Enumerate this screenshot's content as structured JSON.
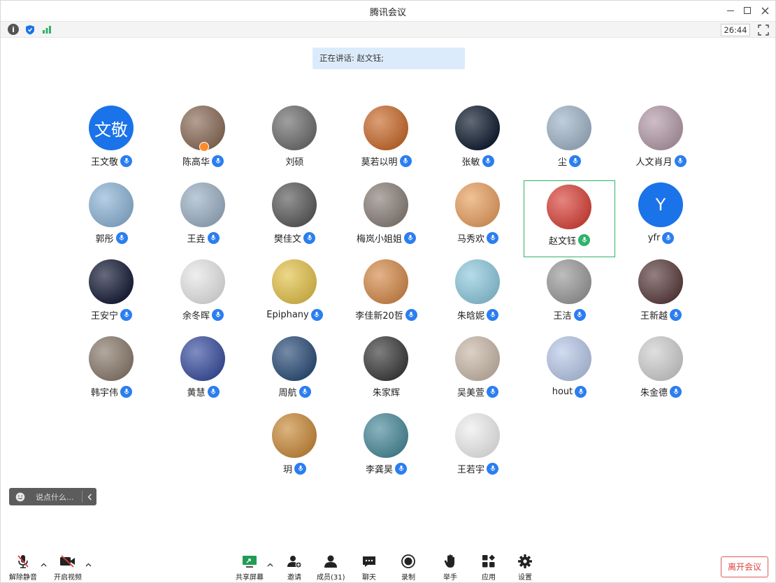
{
  "window": {
    "title": "腾讯会议"
  },
  "status": {
    "timer": "26:44"
  },
  "speaking": {
    "text": "正在讲话: 赵文钰;"
  },
  "participants": [
    {
      "name": "王文敬",
      "avatar_text": "文敬",
      "avatar_color": "#1a73e8",
      "mic": "blue"
    },
    {
      "name": "陈高华",
      "avatar_color": "#8a6b57",
      "mic": "blue",
      "host": true
    },
    {
      "name": "刘硕",
      "avatar_color": "#6d6d6d",
      "mic": "none"
    },
    {
      "name": "莫若以明",
      "avatar_color": "#c96a2b",
      "mic": "blue"
    },
    {
      "name": "张敏",
      "avatar_color": "#0e1a2e",
      "mic": "blue"
    },
    {
      "name": "尘",
      "avatar_color": "#9fb4c8",
      "mic": "blue"
    },
    {
      "name": "人文肖月",
      "avatar_color": "#b39aa8",
      "mic": "blue"
    },
    {
      "name": "郭彤",
      "avatar_color": "#8db4d6",
      "mic": "blue"
    },
    {
      "name": "王垚",
      "avatar_color": "#9bb0c4",
      "mic": "blue"
    },
    {
      "name": "樊佳文",
      "avatar_color": "#5a5a5a",
      "mic": "blue"
    },
    {
      "name": "梅岚小姐姐",
      "avatar_color": "#8a7f78",
      "mic": "blue"
    },
    {
      "name": "马秀欢",
      "avatar_color": "#e8a060",
      "mic": "blue"
    },
    {
      "name": "赵文钰",
      "avatar_color": "#d9433a",
      "mic": "green",
      "active": true
    },
    {
      "name": "yfr",
      "avatar_text": "Y",
      "avatar_color": "#1a73e8",
      "mic": "blue"
    },
    {
      "name": "王安宁",
      "avatar_color": "#141a36",
      "mic": "blue"
    },
    {
      "name": "余冬晖",
      "avatar_color": "#e6e6e6",
      "mic": "blue"
    },
    {
      "name": "Epiphany",
      "avatar_color": "#e3c24a",
      "mic": "blue"
    },
    {
      "name": "李佳新20哲",
      "avatar_color": "#d48a4a",
      "mic": "blue"
    },
    {
      "name": "朱晗妮",
      "avatar_color": "#8ec9de",
      "mic": "blue"
    },
    {
      "name": "王洁",
      "avatar_color": "#9a9a9a",
      "mic": "blue"
    },
    {
      "name": "王新越",
      "avatar_color": "#5a3c3c",
      "mic": "blue"
    },
    {
      "name": "韩宇伟",
      "avatar_color": "#8a7a6c",
      "mic": "blue"
    },
    {
      "name": "黄慧",
      "avatar_color": "#3a4fa0",
      "mic": "blue"
    },
    {
      "name": "周航",
      "avatar_color": "#2b4d78",
      "mic": "blue"
    },
    {
      "name": "朱家辉",
      "avatar_color": "#3a3a3a",
      "mic": "none"
    },
    {
      "name": "吴美萱",
      "avatar_color": "#c9b8a8",
      "mic": "blue"
    },
    {
      "name": "hout",
      "avatar_color": "#b8c8e8",
      "mic": "blue"
    },
    {
      "name": "朱金德",
      "avatar_color": "#cfcfcf",
      "mic": "blue"
    },
    {
      "name": "玥",
      "avatar_color": "#c98a3a",
      "mic": "blue"
    },
    {
      "name": "李龚昊",
      "avatar_color": "#4a8a9a",
      "mic": "blue"
    },
    {
      "name": "王若宇",
      "avatar_color": "#eeeeee",
      "mic": "blue"
    }
  ],
  "chat": {
    "placeholder": "说点什么..."
  },
  "toolbar": {
    "unmute": "解除静音",
    "video": "开启视频",
    "share": "共享屏幕",
    "invite": "邀请",
    "members": "成员(31)",
    "chat": "聊天",
    "record": "录制",
    "raise_hand": "举手",
    "apps": "应用",
    "settings": "设置",
    "leave": "离开会议"
  },
  "colors": {
    "accent": "#2b7ef0",
    "active_border": "#2fb36a",
    "leave": "#e04040"
  }
}
